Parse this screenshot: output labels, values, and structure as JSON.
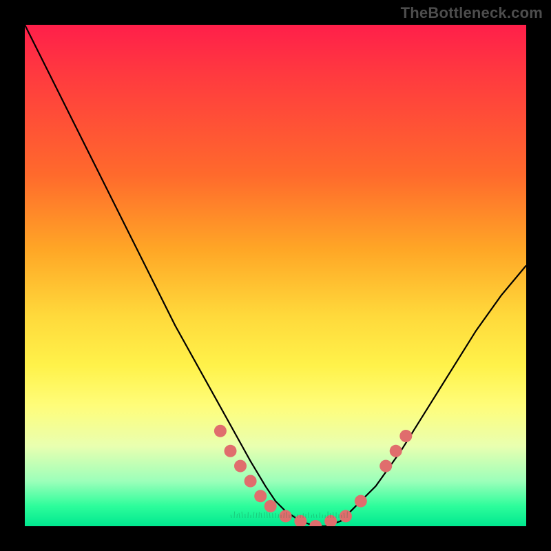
{
  "attribution": "TheBottleneck.com",
  "chart_data": {
    "type": "line",
    "title": "",
    "xlabel": "",
    "ylabel": "",
    "xlim": [
      0,
      100
    ],
    "ylim": [
      0,
      100
    ],
    "series": [
      {
        "name": "curve",
        "x": [
          0,
          5,
          10,
          15,
          20,
          25,
          30,
          35,
          40,
          45,
          48,
          50,
          52,
          55,
          58,
          60,
          63,
          65,
          70,
          75,
          80,
          85,
          90,
          95,
          100
        ],
        "y": [
          100,
          90,
          80,
          70,
          60,
          50,
          40,
          31,
          22,
          13,
          8,
          5,
          3,
          1,
          0,
          0,
          1,
          3,
          8,
          15,
          23,
          31,
          39,
          46,
          52
        ]
      }
    ],
    "markers": [
      {
        "x": 39,
        "y": 19
      },
      {
        "x": 41,
        "y": 15
      },
      {
        "x": 43,
        "y": 12
      },
      {
        "x": 45,
        "y": 9
      },
      {
        "x": 47,
        "y": 6
      },
      {
        "x": 49,
        "y": 4
      },
      {
        "x": 52,
        "y": 2
      },
      {
        "x": 55,
        "y": 1
      },
      {
        "x": 58,
        "y": 0
      },
      {
        "x": 61,
        "y": 1
      },
      {
        "x": 64,
        "y": 2
      },
      {
        "x": 67,
        "y": 5
      },
      {
        "x": 72,
        "y": 12
      },
      {
        "x": 74,
        "y": 15
      },
      {
        "x": 76,
        "y": 18
      }
    ],
    "marker_color": "#e06d6d",
    "marker_radius_px": 9
  }
}
